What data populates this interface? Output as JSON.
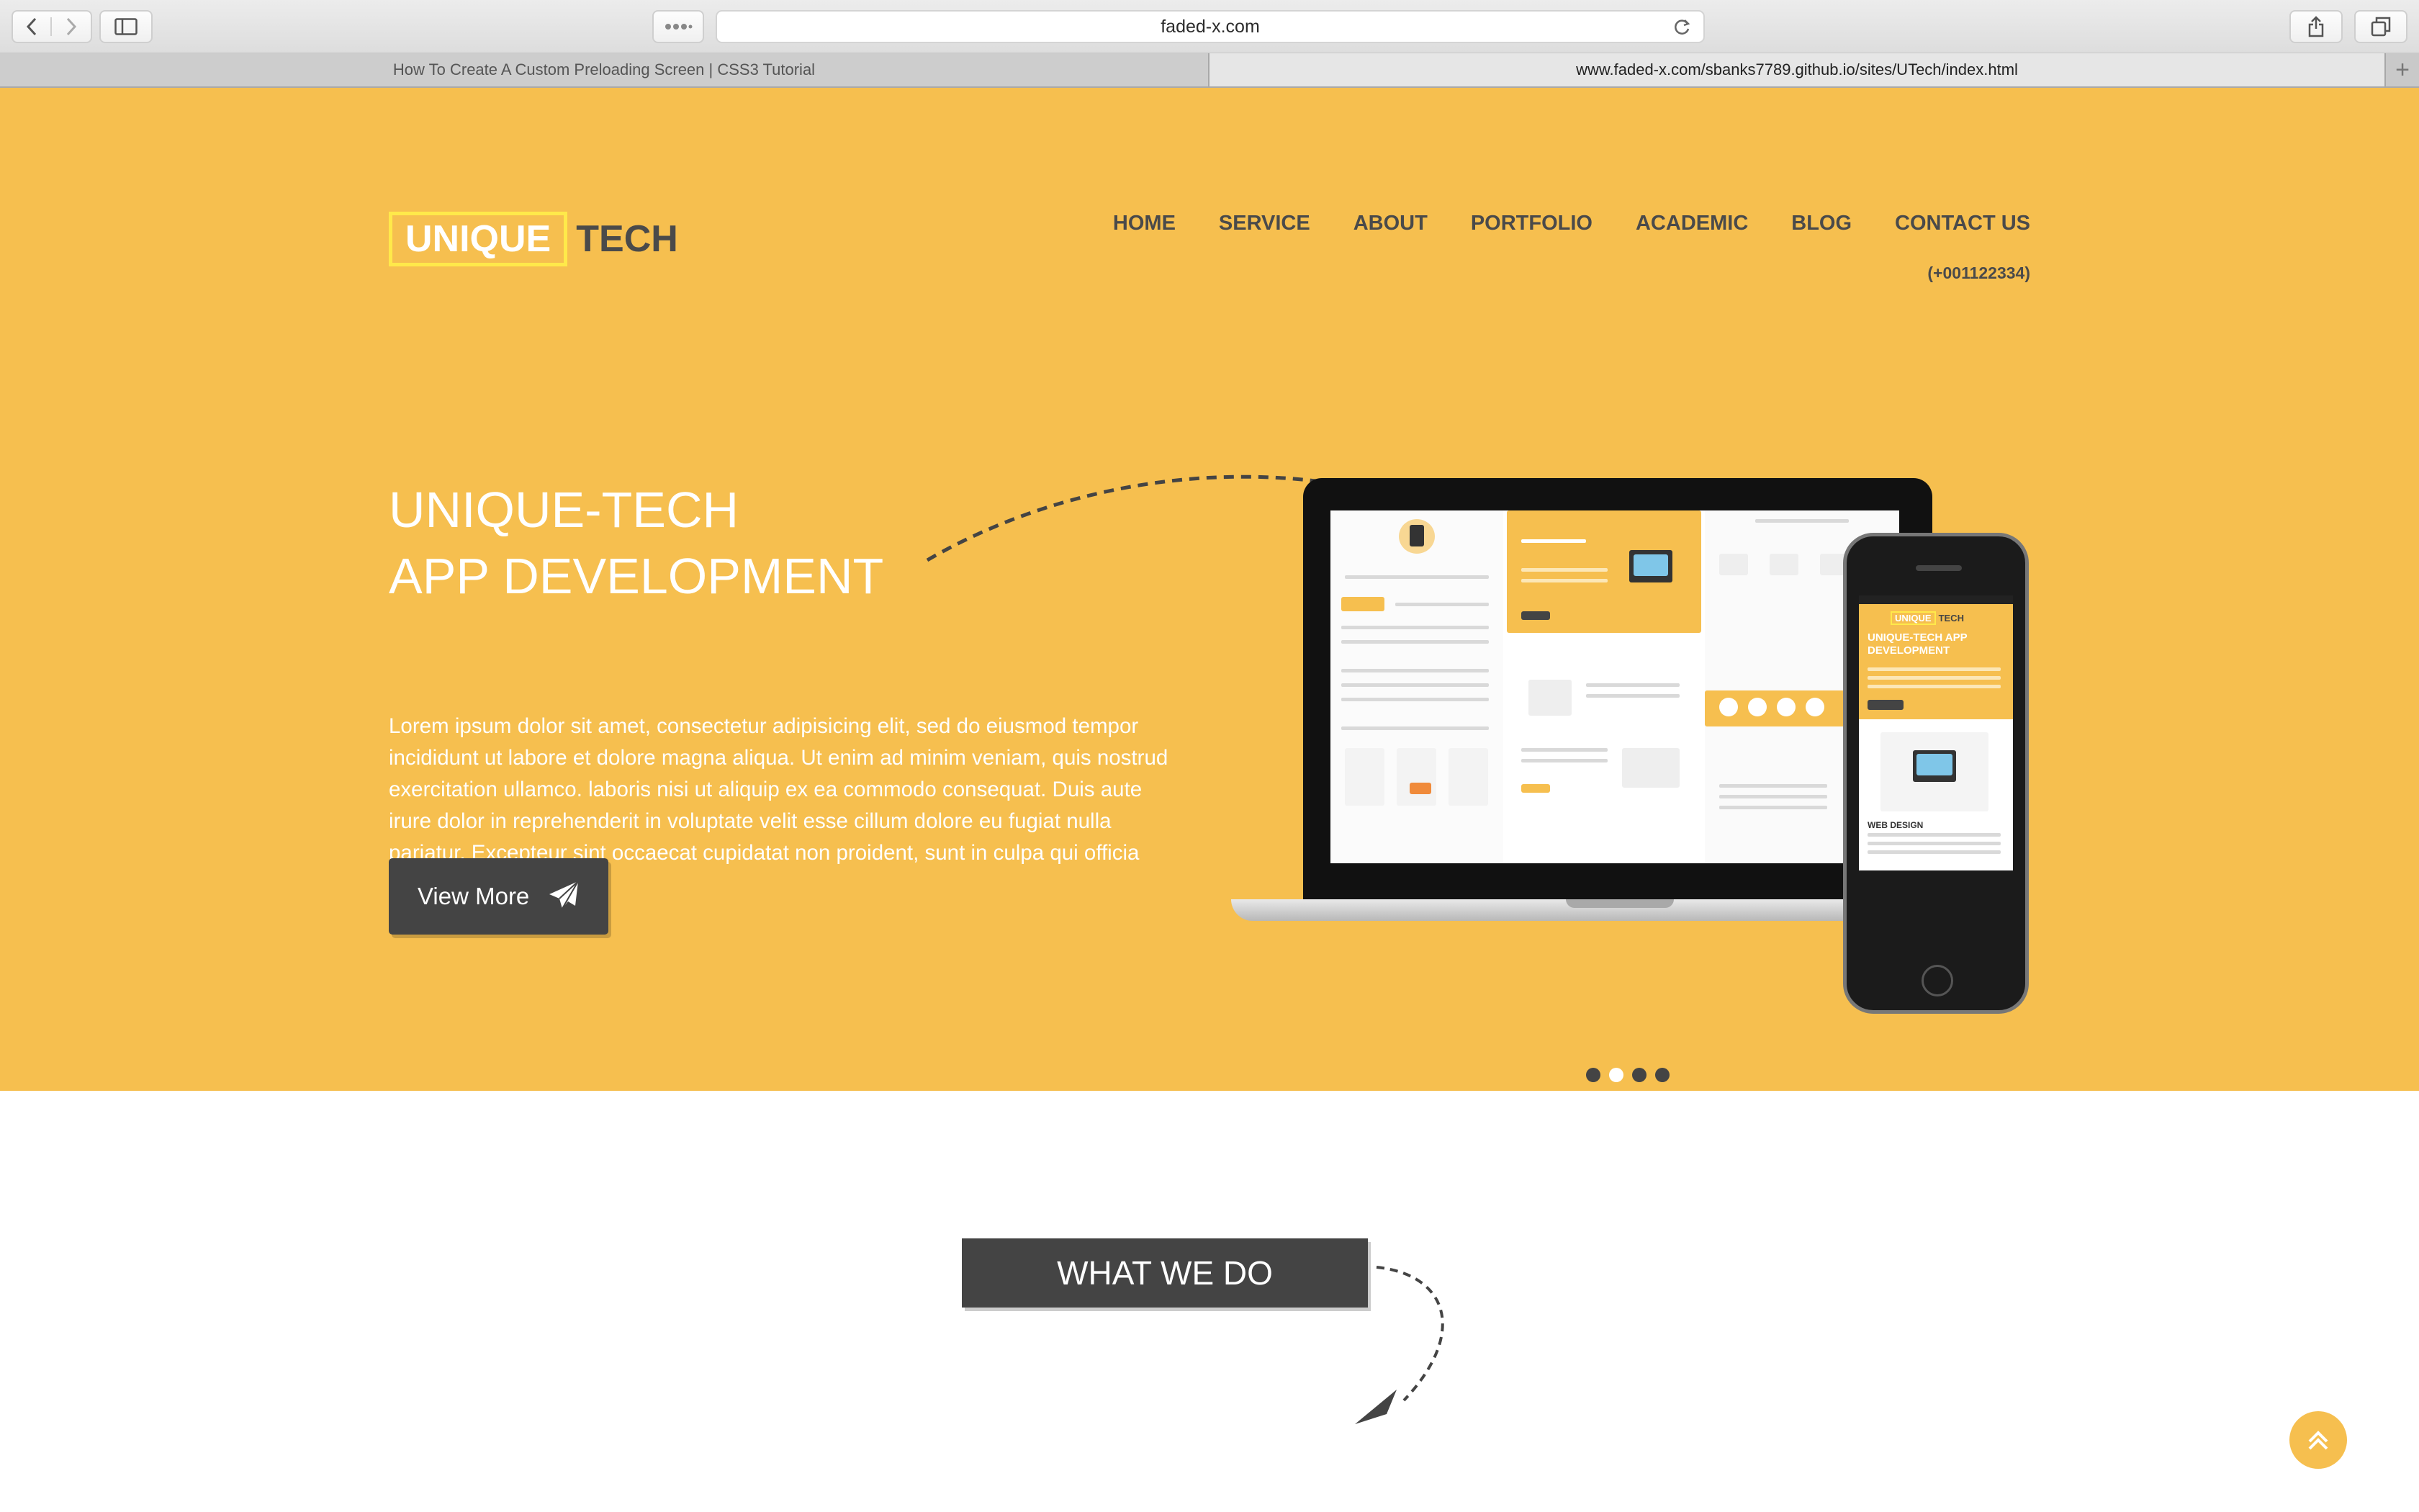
{
  "browser": {
    "address": "faded-x.com",
    "tabs": [
      {
        "label": "How To Create A Custom Preloading Screen | CSS3 Tutorial"
      },
      {
        "label": "www.faded-x.com/sbanks7789.github.io/sites/UTech/index.html"
      }
    ],
    "new_tab_label": "+"
  },
  "site": {
    "logo_primary": "UNIQUE",
    "logo_secondary": "TECH",
    "nav": [
      "HOME",
      "SERVICE",
      "ABOUT",
      "PORTFOLIO",
      "ACADEMIC",
      "BLOG",
      "CONTACT US"
    ],
    "phone": "(+001122334)",
    "hero": {
      "title_line1": "UNIQUE-TECH",
      "title_line2": "APP DEVELOPMENT",
      "body": "Lorem ipsum dolor sit amet, consectetur adipisicing elit, sed do eiusmod tempor incididunt ut labore et dolore magna aliqua. Ut enim ad minim veniam, quis nostrud exercitation ullamco. laboris nisi ut aliquip ex ea commodo consequat. Duis aute irure dolor in reprehenderit in voluptate velit esse cillum dolore eu fugiat nulla pariatur. Excepteur sint occaecat cupidatat non proident, sunt in culpa qui officia deserunt mollit.",
      "button_label": "View More"
    },
    "mockup": {
      "phone_logo_primary": "UNIQUE",
      "phone_logo_secondary": "TECH",
      "phone_title": "UNIQUE-TECH APP DEVELOPMENT",
      "phone_section": "WEB DESIGN"
    },
    "carousel": {
      "count": 4,
      "active_index": 1
    },
    "section_title": "WHAT WE DO"
  },
  "colors": {
    "brand_yellow": "#f6bf4f",
    "dark": "#444444",
    "logo_border": "#ffe94a"
  },
  "icons": [
    "back-icon",
    "forward-icon",
    "sidebar-icon",
    "reader-icon",
    "reload-icon",
    "share-icon",
    "tabs-icon",
    "paper-plane-icon",
    "chevron-up-icon"
  ]
}
